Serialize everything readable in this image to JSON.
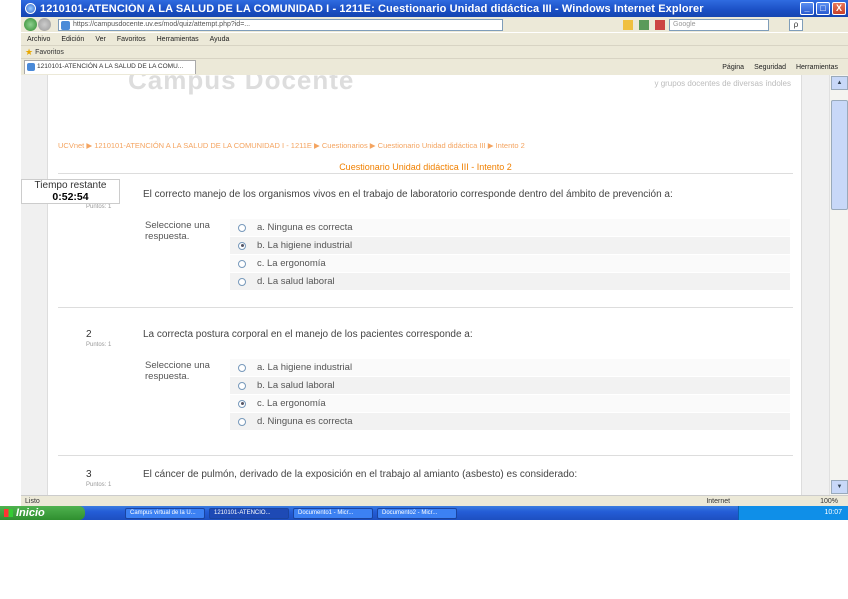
{
  "window": {
    "title": "1210101-ATENCIÓN A LA SALUD DE LA COMUNIDAD I - 1211E: Cuestionario Unidad didáctica III - Windows Internet Explorer",
    "min": "_",
    "max": "□",
    "close": "X"
  },
  "address": {
    "url": "https://campusdocente.uv.es/mod/quiz/attempt.php?id=...",
    "search_placeholder": "Google",
    "search_button": "ρ"
  },
  "menu": [
    "Archivo",
    "Edición",
    "Ver",
    "Favoritos",
    "Herramientas",
    "Ayuda"
  ],
  "favorites": {
    "label": "Favoritos"
  },
  "tab": {
    "label": "1210101-ATENCIÓN A LA SALUD DE LA COMU..."
  },
  "commands": [
    "Página",
    "Seguridad",
    "Herramientas"
  ],
  "page": {
    "logo": "Campus Docente",
    "logo_sub": "y grupos docentes de diversas índoles",
    "breadcrumb": "UCVnet ▶ 1210101-ATENCIÓN A LA SALUD DE LA COMUNIDAD I - 1211E ▶ Cuestionarios ▶ Cuestionario Unidad didáctica III ▶ Intento 2",
    "quiz_title": "Cuestionario Unidad didáctica III - Intento 2",
    "timer_label": "Tiempo restante",
    "timer_value": "0:52:54",
    "prompt": "Seleccione una respuesta.",
    "points_label": "Puntos: 1"
  },
  "questions": [
    {
      "num": "1",
      "text": "El correcto manejo de los organismos vivos en el trabajo de laboratorio corresponde dentro del ámbito de prevención a:",
      "answers": [
        "a. Ninguna es correcta",
        "b. La higiene industrial",
        "c. La ergonomía",
        "d. La salud laboral"
      ],
      "selected": 1
    },
    {
      "num": "2",
      "text": "La correcta postura corporal en el manejo de los pacientes corresponde a:",
      "answers": [
        "a. La higiene industrial",
        "b. La salud laboral",
        "c. La ergonomía",
        "d. Ninguna es correcta"
      ],
      "selected": 2
    },
    {
      "num": "3",
      "text": "El cáncer de pulmón, derivado de la exposición en el trabajo al amianto (asbesto) es considerado:",
      "answers": [],
      "selected": -1
    }
  ],
  "status": {
    "left": "Listo",
    "zone": "Internet",
    "zoom": "100%"
  },
  "taskbar": {
    "start": "Inicio",
    "tasks": [
      "Campus virtual de la U...",
      "1210101-ATENCIÓ...",
      "Documento1 - Micr...",
      "Documento2 - Micr..."
    ],
    "clock": "10:07"
  }
}
